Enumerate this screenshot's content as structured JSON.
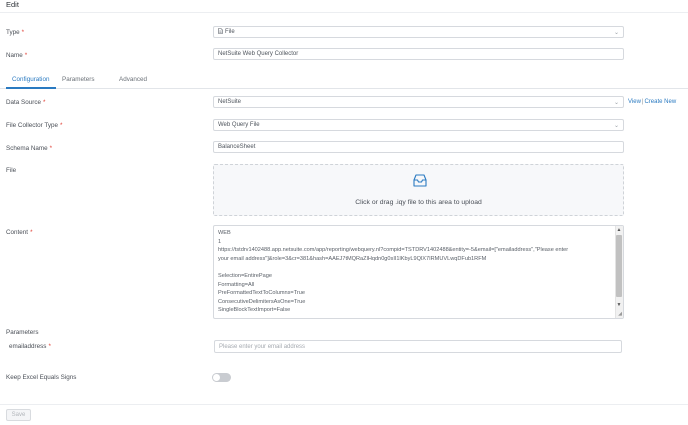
{
  "header": {
    "title": "Edit"
  },
  "form": {
    "type": {
      "label": "Type",
      "value": "File"
    },
    "name": {
      "label": "Name",
      "value": "NetSuite Web Query Collector"
    }
  },
  "tabs": [
    {
      "label": "Configuration",
      "active": true
    },
    {
      "label": "Parameters",
      "active": false
    },
    {
      "label": "Advanced",
      "active": false
    }
  ],
  "config": {
    "data_source": {
      "label": "Data Source",
      "value": "NetSuite"
    },
    "links": {
      "view": "View",
      "separator": "|",
      "create_new": "Create New"
    },
    "file_collector_type": {
      "label": "File Collector Type",
      "value": "Web Query File"
    },
    "schema_name": {
      "label": "Schema Name",
      "value": "BalanceSheet"
    },
    "file": {
      "label": "File",
      "upload_text": "Click or drag .iqy file to this area to upload"
    },
    "content": {
      "label": "Content",
      "lines": [
        "WEB",
        "1",
        "https://tstdrv1402488.app.netsuite.com/app/reporting/webquery.nl?compid=TSTDRV1402488&entity=-5&email=[\"emailaddress\",\"Please enter",
        "your email address\"]&role=3&cr=381&hash=AAEJ7tMQRaZlHqdn0g0sII1lKbyL9QlX7IRMUVLwqDFub1RFM",
        "",
        "Selection=EntirePage",
        "Formatting=All",
        "PreFormattedTextToColumns=True",
        "ConsecutiveDelimitersAsOne=True",
        "SingleBlockTextImport=False"
      ]
    },
    "parameters": {
      "heading": "Parameters",
      "emailaddress": {
        "label": "emailaddress",
        "placeholder": "Please enter your email address"
      }
    },
    "keep_excel_equals": {
      "label": "Keep Excel Equals Signs",
      "enabled": false
    }
  },
  "footer": {
    "save_label": "Save"
  },
  "colors": {
    "accent": "#2a7ac1",
    "required": "#e03c31",
    "border": "#d6d9de"
  }
}
